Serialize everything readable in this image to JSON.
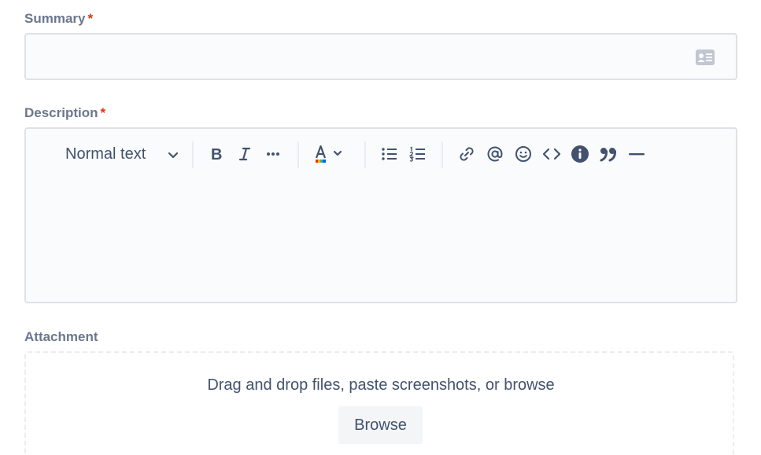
{
  "summary": {
    "label": "Summary",
    "required_mark": "*",
    "value": "",
    "icon": "contact-card-icon"
  },
  "description": {
    "label": "Description",
    "required_mark": "*",
    "value": "",
    "toolbar": {
      "text_style": "Normal text",
      "icons": [
        "bold-icon",
        "italic-icon",
        "more-formatting-icon",
        "text-color-icon",
        "bullet-list-icon",
        "numbered-list-icon",
        "link-icon",
        "mention-icon",
        "emoji-icon",
        "code-icon",
        "info-panel-icon",
        "quote-icon",
        "divider-icon"
      ]
    }
  },
  "attachment": {
    "label": "Attachment",
    "drop_text": "Drag and drop files, paste screenshots, or browse",
    "browse_label": "Browse"
  },
  "colors": {
    "label": "#6b778c",
    "required": "#de350b",
    "icon": "#42526e",
    "field_bg": "#fafbfc",
    "border": "#dfe1e6"
  }
}
